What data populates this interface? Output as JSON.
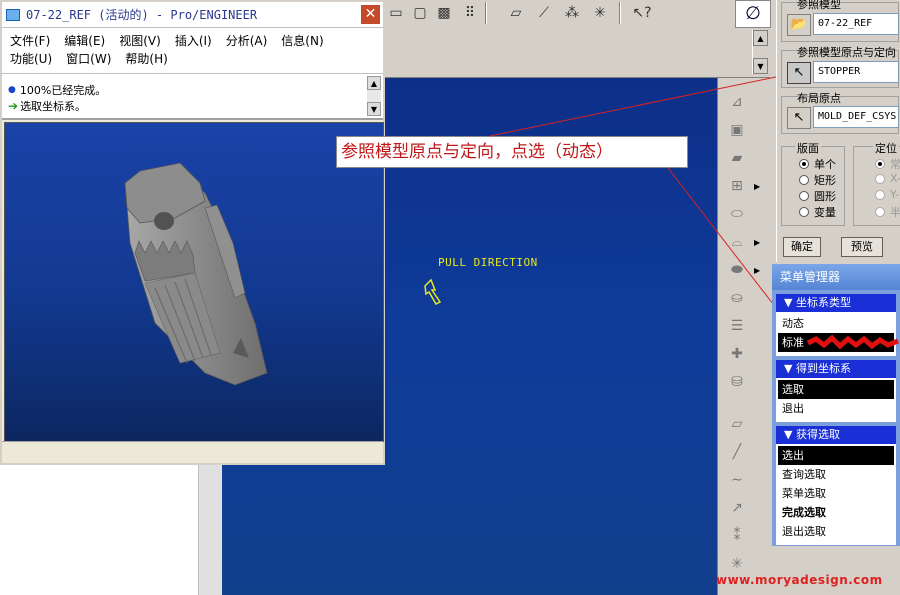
{
  "window": {
    "title": "07-22_REF (活动的) - Pro/ENGINEER",
    "menus_row1": [
      "文件(F)",
      "编辑(E)",
      "视图(V)",
      "插入(I)",
      "分析(A)",
      "信息(N)"
    ],
    "menus_row2": [
      "功能(U)",
      "窗口(W)",
      "帮助(H)"
    ],
    "messages": [
      "100%已经完成。",
      "选取坐标系。"
    ]
  },
  "graphics": {
    "pull_direction_label": "PULL DIRECTION"
  },
  "callout": {
    "text": "参照模型原点与定向，点选（动态）"
  },
  "right_panel": {
    "ref_model_label": "参照模型",
    "ref_model_value": "07-22_REF",
    "origin_label": "参照模型原点与定向",
    "origin_value": "STOPPER",
    "layout_origin_label": "布局原点",
    "layout_origin_value": "MOLD_DEF_CSYS",
    "plate_label": "版面",
    "position_label": "定位",
    "plate_options": [
      "单个",
      "矩形",
      "圆形",
      "变量"
    ],
    "position_options": [
      "常",
      "X-",
      "Y-",
      "半"
    ],
    "ok_label": "确定",
    "preview_label": "预览"
  },
  "menu_manager": {
    "title": "菜单管理器",
    "sections": [
      {
        "header": "坐标系类型",
        "items": [
          "动态",
          "标准"
        ]
      },
      {
        "header": "得到坐标系",
        "items": [
          "选取",
          "退出"
        ]
      },
      {
        "header": "获得选取",
        "items": [
          "选出",
          "查询选取",
          "菜单选取",
          "完成选取",
          "退出选取"
        ]
      }
    ]
  },
  "watermark": "www.moryadesign.com",
  "colors": {
    "viewport_blue": "#12398f",
    "callout_text": "#c01818",
    "menu_section_header": "#1a2fd6",
    "pull_label": "#e8e818"
  }
}
